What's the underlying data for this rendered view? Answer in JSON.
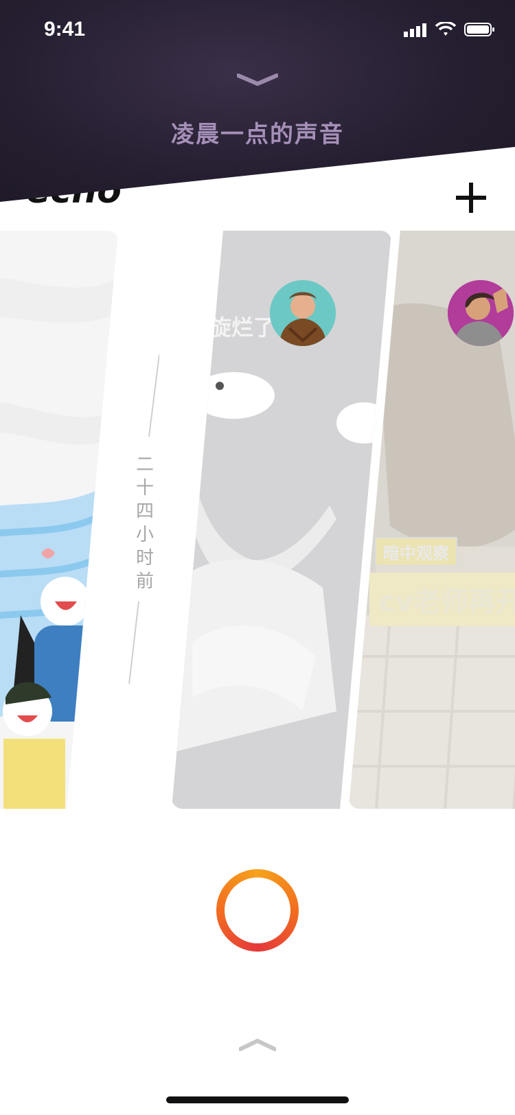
{
  "status": {
    "time": "9:41"
  },
  "header": {
    "title": "凌晨一点的声音"
  },
  "brand": {
    "logo": "echo"
  },
  "toolbar": {
    "plus_icon": "plus-icon"
  },
  "cards": {
    "left": {
      "description": "illustrated"
    },
    "middle": {
      "caption": "旋烂了"
    },
    "right": {
      "badge": "暗中观察",
      "caption": "cv老师再开"
    }
  },
  "timestamp": {
    "label": "二十四小时前"
  },
  "colors": {
    "panel": "#261f31",
    "title": "#a590b8",
    "ring_start": "#f6a21c",
    "ring_end": "#e5383b"
  }
}
